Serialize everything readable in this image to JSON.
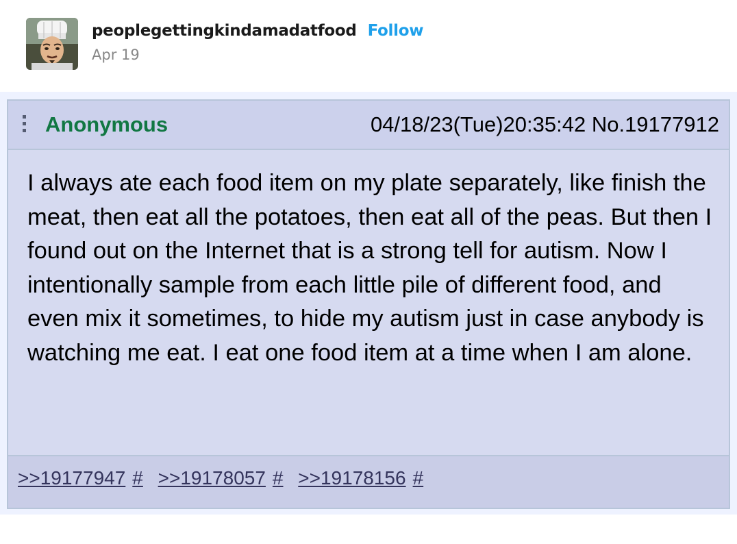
{
  "post": {
    "blog_name": "peoplegettingkindamadatfood",
    "follow_label": "Follow",
    "date": "Apr 19"
  },
  "chan_post": {
    "poster_name": "Anonymous",
    "datetime": "04/18/23(Tue)20:35:42",
    "post_number": "No.19177912",
    "body": "I always ate each food item on my plate separately, like finish the meat, then eat all the potatoes, then eat all of the peas. But then I found out on the Internet that is a strong tell for autism. Now I intentionally sample from each little pile of different food, and even mix it sometimes, to hide my autism just in case anybody is watching me eat. I eat one food item at a time when I am alone.",
    "replies": [
      {
        "ref": ">>19177947",
        "hash": "#"
      },
      {
        "ref": ">>19178057",
        "hash": "#"
      },
      {
        "ref": ">>19178156",
        "hash": "#"
      }
    ]
  },
  "colors": {
    "name_green": "#117743",
    "follow_blue": "#1fa0ea",
    "post_bg": "#d6daf0",
    "link": "#34345c"
  },
  "icons": {
    "avatar": "chef-avatar-icon",
    "menu": "vertical-dots-menu-icon"
  }
}
